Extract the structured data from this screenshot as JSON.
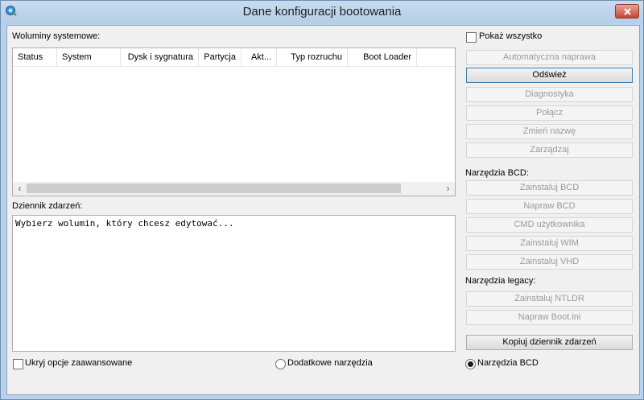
{
  "window": {
    "title": "Dane konfiguracji bootowania"
  },
  "volumes": {
    "label": "Woluminy systemowe:",
    "columns": [
      "Status",
      "System",
      "Dysk i sygnatura",
      "Partycja",
      "Akt...",
      "Typ rozruchu",
      "Boot Loader"
    ]
  },
  "log": {
    "label": "Dziennik zdarzeń:",
    "text": "Wybierz wolumin, który chcesz edytować..."
  },
  "show_all": {
    "label": "Pokaż wszystko",
    "checked": false
  },
  "buttons": {
    "auto_repair": "Automatyczna naprawa",
    "refresh": "Odśwież",
    "diagnostics": "Diagnostyka",
    "connect": "Połącz",
    "rename": "Zmień nazwę",
    "manage": "Zarządzaj",
    "install_bcd": "Zainstaluj BCD",
    "repair_bcd": "Napraw BCD",
    "user_cmd": "CMD użytkownika",
    "install_wim": "Zainstaluj WIM",
    "install_vhd": "Zainstaluj VHD",
    "install_ntldr": "Zainstaluj NTLDR",
    "repair_bootini": "Napraw Boot.ini",
    "copy_log": "Kopiuj dziennik zdarzeń"
  },
  "sections": {
    "bcd_tools": "Narzędzia BCD:",
    "legacy_tools": "Narzędzia legacy:"
  },
  "bottom": {
    "hide_advanced": "Ukryj opcje zaawansowane",
    "extra_tools": "Dodatkowe narzędzia",
    "bcd_tools": "Narzędzia BCD",
    "selected_mode": "bcd_tools"
  },
  "icons": {
    "app": "boot-config-icon",
    "close": "close-icon",
    "scroll_left": "chevron-left-icon",
    "scroll_right": "chevron-right-icon"
  },
  "colors": {
    "titlebar": "#b9d1ea",
    "close_button": "#c8442f",
    "client": "#f0f0f0",
    "disabled_text": "#9a9a9a"
  }
}
